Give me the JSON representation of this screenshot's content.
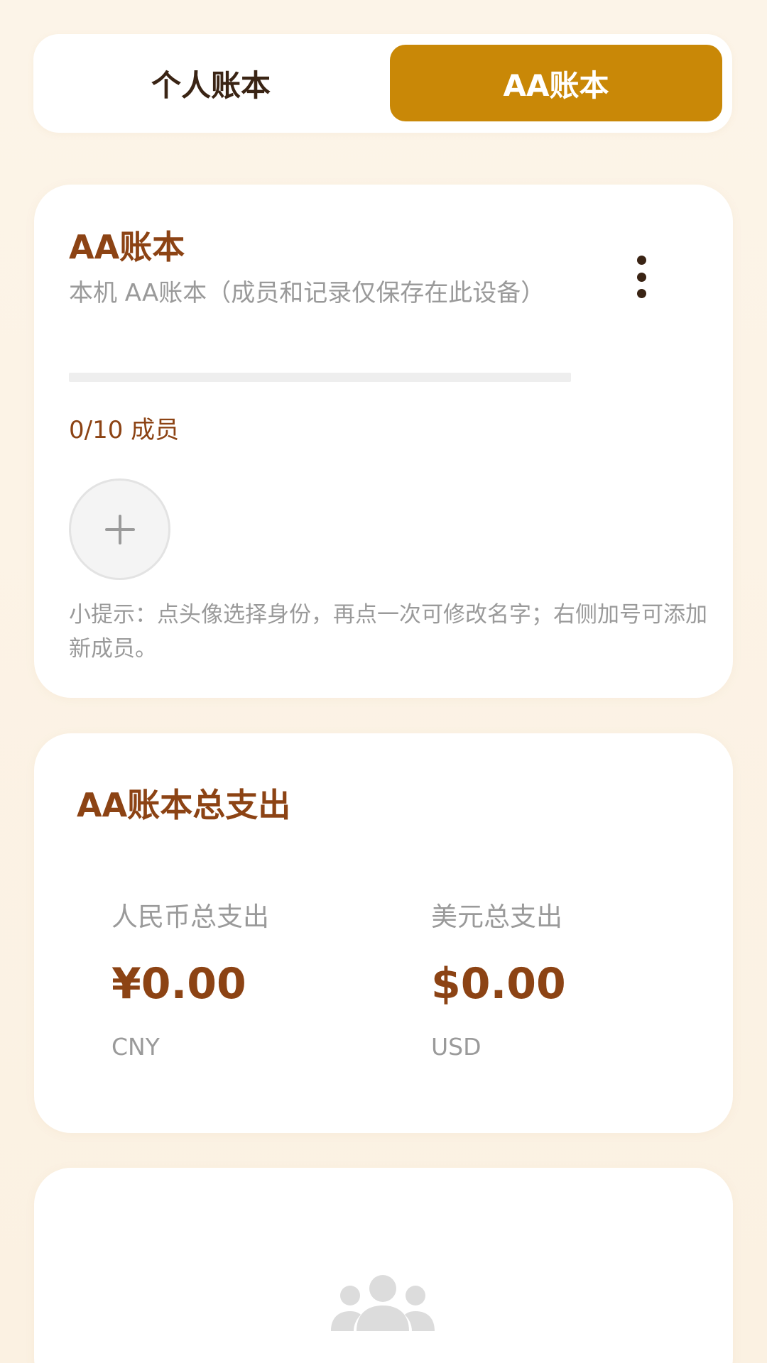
{
  "tabs": {
    "personal_label": "个人账本",
    "aa_label": "AA账本",
    "active": "aa"
  },
  "ledger": {
    "title": "AA账本",
    "description": "本机 AA账本（成员和记录仅保存在此设备）",
    "member_count": "0/10 成员",
    "hint": "小提示：点头像选择身份，再点一次可修改名字；右侧加号可添加新成员。",
    "more_icon": "more-vertical-icon",
    "add_icon": "plus-icon"
  },
  "totals": {
    "title": "AA账本总支出",
    "cny": {
      "label": "人民币总支出",
      "amount": "¥0.00",
      "code": "CNY"
    },
    "usd": {
      "label": "美元总支出",
      "amount": "$0.00",
      "code": "USD"
    }
  },
  "empty_state": {
    "icon": "group-people-icon"
  },
  "colors": {
    "accent": "#c98807",
    "brand_text": "#8c4314",
    "muted_text": "#9a9a9a",
    "background": "#fbf2e4"
  }
}
